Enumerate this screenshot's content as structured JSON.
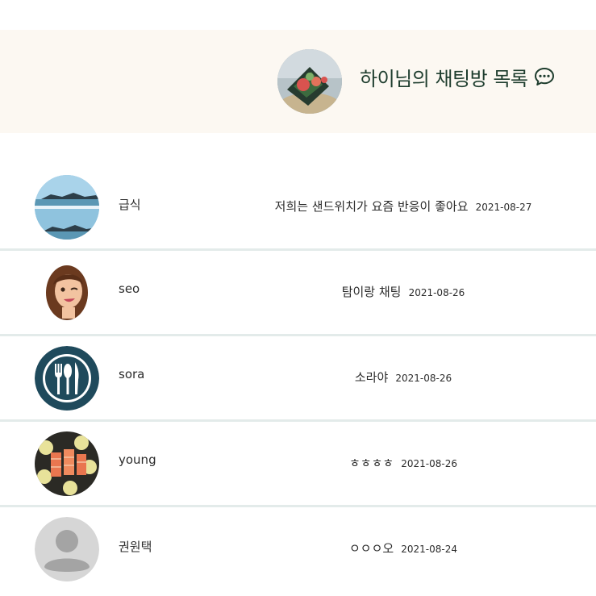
{
  "header": {
    "title": "하이님의 채팅방 목록",
    "avatar_icon": "sandwich-photo",
    "chat_icon": "chat-bubble-dots-icon",
    "background": "#fcf8f2",
    "title_color": "#1e3d2e"
  },
  "rooms": [
    {
      "name": "급식",
      "last_message": "저희는 샌드위치가 요즘 반응이 좋아요",
      "date": "2021-08-27",
      "avatar": "sea-landscape-photo"
    },
    {
      "name": "seo",
      "last_message": "탐이랑 채팅",
      "date": "2021-08-26",
      "avatar": "memoji-girl"
    },
    {
      "name": "sora",
      "last_message": "소라야",
      "date": "2021-08-26",
      "avatar": "cutlery-logo"
    },
    {
      "name": "young",
      "last_message": "ㅎㅎㅎㅎ",
      "date": "2021-08-26",
      "avatar": "salmon-lemon-photo"
    },
    {
      "name": "권원택",
      "last_message": "ㅇㅇㅇ오",
      "date": "2021-08-24",
      "avatar": "default-user-avatar"
    }
  ],
  "colors": {
    "divider": "#e3ebea",
    "text": "#2b2b2b"
  }
}
